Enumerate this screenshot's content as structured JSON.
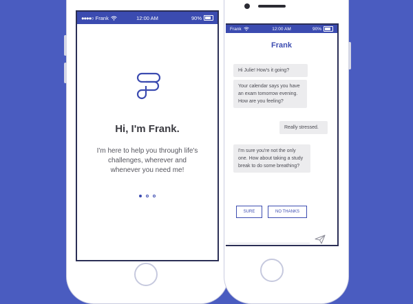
{
  "colors": {
    "background": "#4a5cc0",
    "accent": "#3b4bb0",
    "bubble": "#ececee"
  },
  "left_phone": {
    "status_bar": {
      "signal": "●●●●○",
      "carrier": "Frank",
      "time": "12:00 AM",
      "battery": "90%"
    },
    "title": "Hi, I'm Frank.",
    "body": "I'm here to help you through life's challenges, wherever and whenever you need me!",
    "pager": {
      "count": 3,
      "active_index": 0
    }
  },
  "right_phone": {
    "status_bar": {
      "carrier": "Frank",
      "time": "12:00 AM",
      "battery": "90%"
    },
    "title": "Frank",
    "messages": [
      {
        "from": "bot",
        "text": "Hi Julie! How's it going?"
      },
      {
        "from": "bot",
        "text": "Your calendar says you have an exam tomorrow evening. How are you feeling?"
      },
      {
        "from": "user",
        "text": "Really stressed."
      },
      {
        "from": "bot",
        "text": "I'm sure you're not the only one. How about taking a study break to do some breathing?"
      }
    ],
    "actions": {
      "sure": "SURE",
      "no_thanks": "NO THANKS"
    },
    "icons": {
      "send": "send-icon"
    }
  }
}
